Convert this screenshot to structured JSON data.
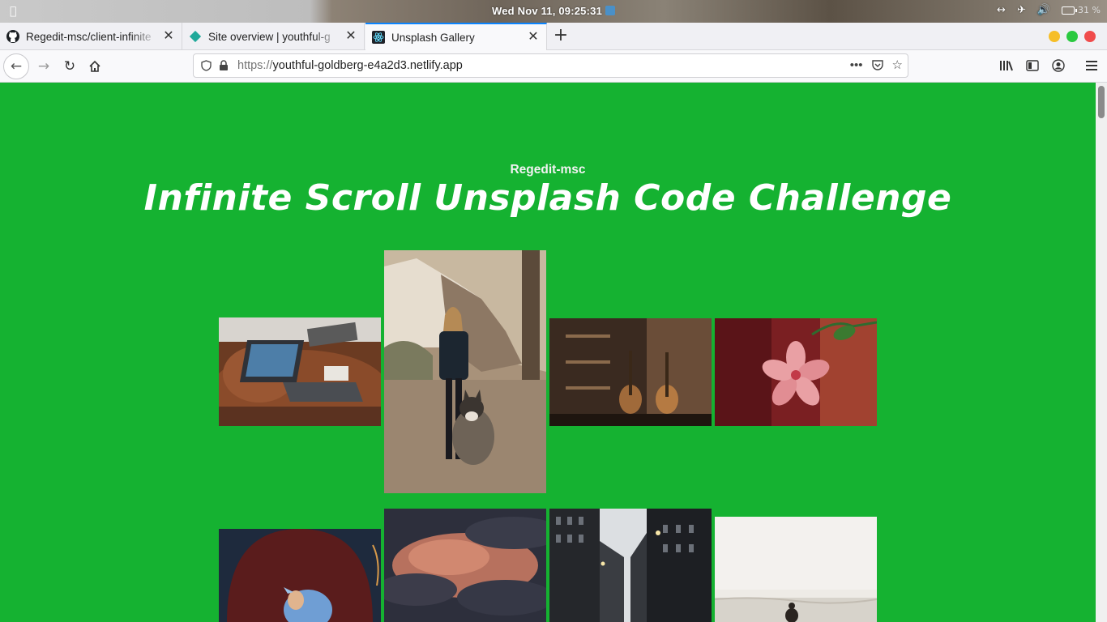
{
  "os": {
    "clock": "Wed Nov 11, 09:25:31",
    "battery_text": "31 %"
  },
  "tabs": [
    {
      "title": "Regedit-msc/client-infinite",
      "icon": "github-icon"
    },
    {
      "title": "Site overview | youthful-g",
      "icon": "netlify-icon"
    },
    {
      "title": "Unsplash Gallery",
      "icon": "react-icon",
      "active": true
    }
  ],
  "url": {
    "scheme": "https://",
    "host": "youthful-goldberg-e4a2d3.netlify.app"
  },
  "page": {
    "author": "Regedit-msc",
    "heading": "Infinite Scroll Unsplash Code Challenge"
  },
  "gallery": [
    {
      "name": "photo-laptop-on-couch"
    },
    {
      "name": "photo-woman-with-husky"
    },
    {
      "name": "photo-guitars-in-room"
    },
    {
      "name": "photo-pink-flower"
    },
    {
      "name": "photo-child-in-hood"
    },
    {
      "name": "photo-sunset-clouds"
    },
    {
      "name": "photo-city-street"
    },
    {
      "name": "photo-beach-walker"
    }
  ],
  "colors": {
    "page_background": "#15b231",
    "tab_accent": "#0a84ff"
  }
}
